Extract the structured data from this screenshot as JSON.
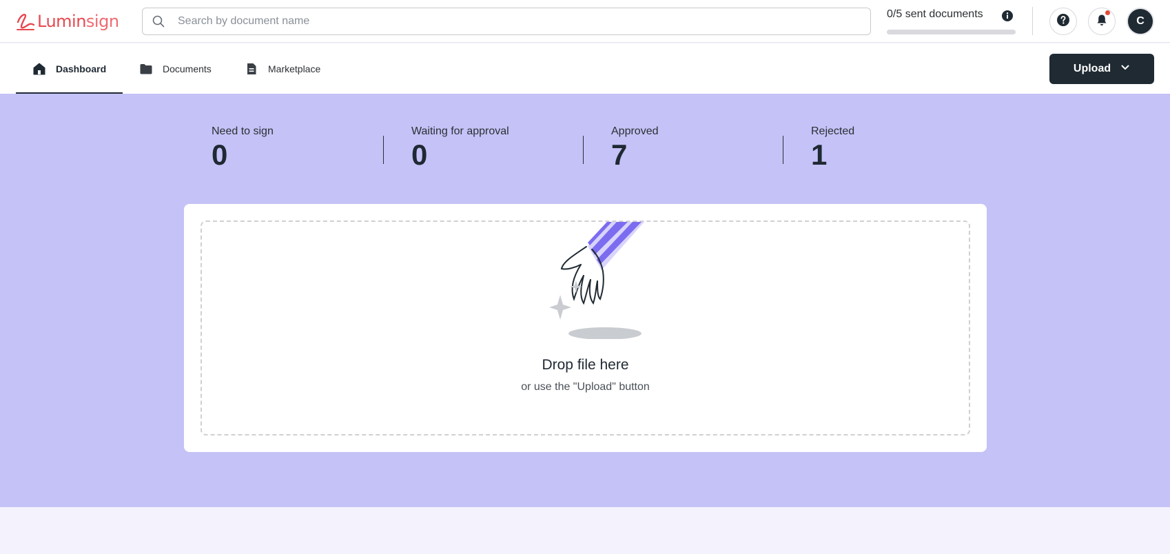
{
  "brand": {
    "name_part1": "Lumin",
    "name_part2": "sign",
    "color": "#e8474f"
  },
  "search": {
    "placeholder": "Search by document name",
    "value": ""
  },
  "quota": {
    "text": "0/5 sent documents",
    "sent": 0,
    "limit": 5
  },
  "header_actions": {
    "help_icon": "question-circle-icon",
    "notifications_icon": "bell-icon",
    "has_notification": true,
    "avatar_initial": "C"
  },
  "nav": {
    "tabs": [
      {
        "label": "Dashboard",
        "icon": "home-icon",
        "active": true
      },
      {
        "label": "Documents",
        "icon": "folder-icon",
        "active": false
      },
      {
        "label": "Marketplace",
        "icon": "document-icon",
        "active": false
      }
    ],
    "upload_label": "Upload"
  },
  "stats": [
    {
      "label": "Need to sign",
      "value": "0"
    },
    {
      "label": "Waiting for approval",
      "value": "0"
    },
    {
      "label": "Approved",
      "value": "7"
    },
    {
      "label": "Rejected",
      "value": "1"
    }
  ],
  "dropzone": {
    "title": "Drop file here",
    "subtitle": "or use the \"Upload\" button"
  },
  "colors": {
    "hero_bg": "#c5c2f7",
    "page_bg": "#f4f2fd",
    "primary_dark": "#1f2a33",
    "accent_purple": "#7b6cf0"
  }
}
